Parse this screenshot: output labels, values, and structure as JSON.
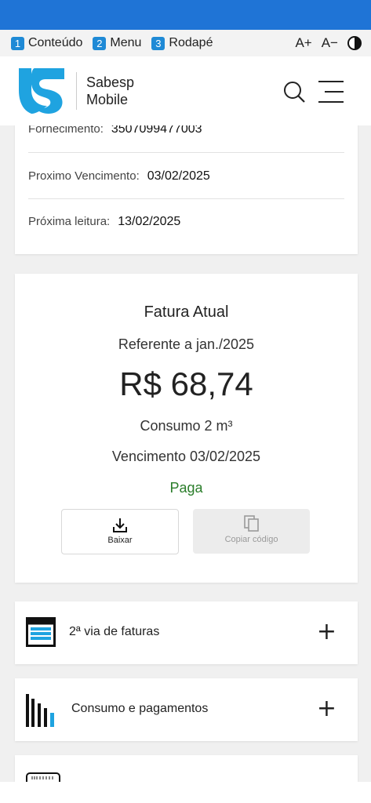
{
  "accessibility": {
    "items": [
      {
        "num": "1",
        "label": "Conteúdo"
      },
      {
        "num": "2",
        "label": "Menu"
      },
      {
        "num": "3",
        "label": "Rodapé"
      }
    ],
    "font_increase": "A+",
    "font_decrease": "A−"
  },
  "header": {
    "brand_line1": "Sabesp",
    "brand_line2": "Mobile"
  },
  "info": {
    "fornecimento_label": "Fornecimento:",
    "fornecimento_value": "3507099477003",
    "vencimento_label": "Proximo Vencimento:",
    "vencimento_value": "03/02/2025",
    "leitura_label": "Próxima leitura:",
    "leitura_value": "13/02/2025"
  },
  "fatura": {
    "title": "Fatura Atual",
    "referente": "Referente a jan./2025",
    "amount": "R$ 68,74",
    "consumo": "Consumo 2 m³",
    "vencimento": "Vencimento 03/02/2025",
    "status": "Paga",
    "baixar_label": "Baixar",
    "copiar_label": "Copiar código"
  },
  "sections": [
    {
      "label": "2ª via de faturas",
      "icon": "invoice-icon"
    },
    {
      "label": "Consumo e pagamentos",
      "icon": "bar-chart-icon"
    }
  ],
  "colors": {
    "top_bar": "#1f74d6",
    "accent": "#1fa3e0",
    "paid_green": "#2a7d2a"
  }
}
